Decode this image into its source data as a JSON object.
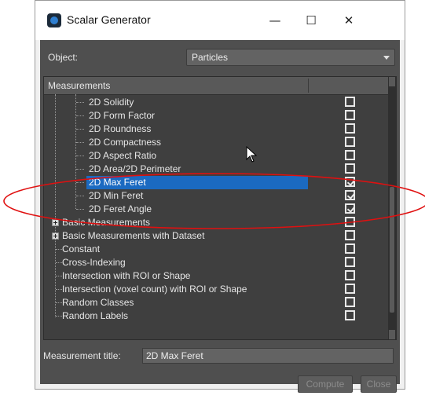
{
  "window": {
    "title": "Scalar Generator",
    "controls": {
      "minimize": "—",
      "maximize": "☐",
      "close": "✕"
    }
  },
  "object": {
    "label": "Object:",
    "value": "Particles"
  },
  "tree": {
    "header": "Measurements",
    "rows": [
      {
        "label": "2D Solidity",
        "checked": false,
        "selected": false
      },
      {
        "label": "2D Form Factor",
        "checked": false,
        "selected": false
      },
      {
        "label": "2D Roundness",
        "checked": false,
        "selected": false
      },
      {
        "label": "2D Compactness",
        "checked": false,
        "selected": false
      },
      {
        "label": "2D Aspect Ratio",
        "checked": false,
        "selected": false
      },
      {
        "label": "2D Area/2D Perimeter",
        "checked": false,
        "selected": false
      },
      {
        "label": "2D Max Feret",
        "checked": true,
        "selected": true
      },
      {
        "label": "2D Min Feret",
        "checked": true,
        "selected": false
      },
      {
        "label": "2D Feret Angle",
        "checked": true,
        "selected": false
      },
      {
        "label": "Basic Measurements",
        "checked": false,
        "selected": false,
        "expandable": true
      },
      {
        "label": "Basic Measurements with Dataset",
        "checked": false,
        "selected": false,
        "expandable": true
      },
      {
        "label": "Constant",
        "checked": false,
        "selected": false
      },
      {
        "label": "Cross-Indexing",
        "checked": false,
        "selected": false
      },
      {
        "label": "Intersection with ROI or Shape",
        "checked": false,
        "selected": false
      },
      {
        "label": "Intersection (voxel count) with ROI or Shape",
        "checked": false,
        "selected": false
      },
      {
        "label": "Random Classes",
        "checked": false,
        "selected": false
      },
      {
        "label": "Random Labels",
        "checked": false,
        "selected": false
      }
    ]
  },
  "measurement_title": {
    "label": "Measurement title:",
    "value": "2D Max Feret"
  },
  "buttons": {
    "compute": "Compute",
    "close": "Close"
  },
  "annotation": {
    "color": "#e01010",
    "shape": "ellipse"
  }
}
